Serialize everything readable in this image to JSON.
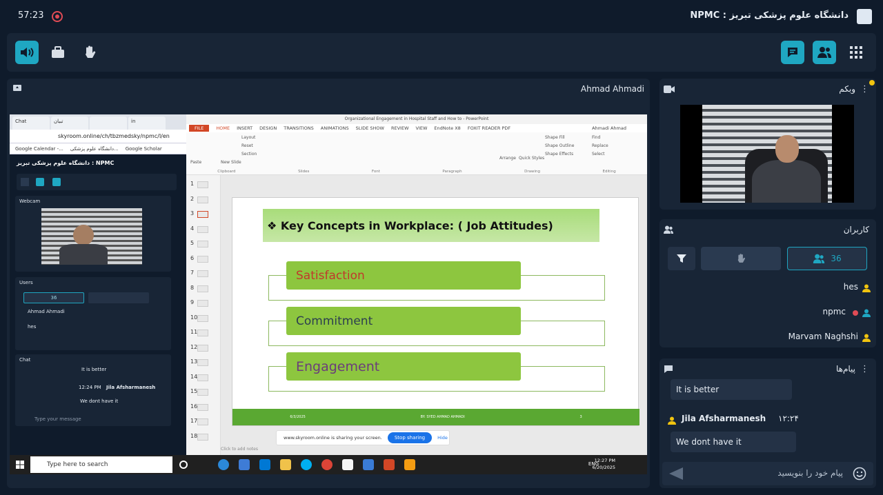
{
  "top": {
    "timer": "57:23",
    "brand": "دانشگاه علوم پزشکی تبریز : NPMC"
  },
  "presenter": {
    "name": "Ahmad Ahmadi"
  },
  "browser": {
    "tabs": [
      "Chat",
      "تبیان",
      "",
      "in",
      "..."
    ],
    "address": "skyroom.online/ch/tbzmedsky/npmc/l/en",
    "bookmarks": [
      "Google Calendar -...",
      "دانشگاه علوم پزشکی...",
      "Google Scholar"
    ],
    "room_title": "دانشگاه علوم پزشکی تبریز : NPMC",
    "webcam_label": "Webcam",
    "users_label": "Users",
    "users_count": "36",
    "users": [
      "Ahmad Ahmadi",
      "hes"
    ],
    "chat_label": "Chat",
    "chat_msg1": "It is better",
    "chat_time": "12:24 PM",
    "chat_sender": "Jila Afsharmanesh",
    "chat_msg2": "We dont have it",
    "chat_placeholder": "Type your message"
  },
  "ppt": {
    "title": "Organizational Engagement in Hospital Staff and How to - PowerPoint",
    "user": "Ahmadi Ahmad",
    "tabs": [
      "FILE",
      "HOME",
      "INSERT",
      "DESIGN",
      "TRANSITIONS",
      "ANIMATIONS",
      "SLIDE SHOW",
      "REVIEW",
      "VIEW",
      "EndNote X8",
      "FOXIT READER PDF"
    ],
    "groups": [
      "Clipboard",
      "Slides",
      "Font",
      "Paragraph",
      "Drawing",
      "Editing"
    ],
    "ribbon_items": [
      "Paste",
      "Layout",
      "Reset",
      "New Slide",
      "Section",
      "Arrange",
      "Quick Styles",
      "Shape Fill",
      "Shape Outline",
      "Shape Effects",
      "Find",
      "Replace",
      "Select"
    ],
    "slide_numbers": [
      "1",
      "2",
      "3",
      "4",
      "5",
      "6",
      "7",
      "8",
      "9",
      "10",
      "11",
      "12",
      "13",
      "14",
      "15",
      "16",
      "17",
      "18"
    ],
    "slide_heading": "❖ Key Concepts in Workplace: ( Job Attitudes)",
    "concepts": [
      {
        "label": "Satisfaction",
        "color": "#c0392b"
      },
      {
        "label": "Commitment",
        "color": "#2c3e50"
      },
      {
        "label": "Engagement",
        "color": "#6a3d7a"
      }
    ],
    "footer": [
      "6/3/2025",
      "BY: SYED AHMAD AHMADI",
      "3"
    ],
    "notes_placeholder": "Click to add notes",
    "sharing_text": "www.skyroom.online is sharing your screen.",
    "stop_sharing": "Stop sharing",
    "hide": "Hide"
  },
  "taskbar": {
    "search": "Type here to search",
    "lang": "ENG",
    "time": "12:27 PM",
    "date": "6/20/2025"
  },
  "webcam_panel": {
    "title": "وبکم"
  },
  "users_panel": {
    "title": "کاربران",
    "count": "36",
    "users": [
      "hes",
      "npmc",
      "Marvam Naghshi"
    ]
  },
  "chat_panel": {
    "title": "پیام‌ها",
    "msg1": "It is better",
    "sender": "Jila Afsharmanesh",
    "time": "۱۲:۲۴",
    "msg2": "We dont have it",
    "placeholder": "پیام خود را بنویسید"
  },
  "colors": {
    "accent": "#1fa7c2",
    "bg": "#0f1b2b",
    "panel": "#182536"
  }
}
